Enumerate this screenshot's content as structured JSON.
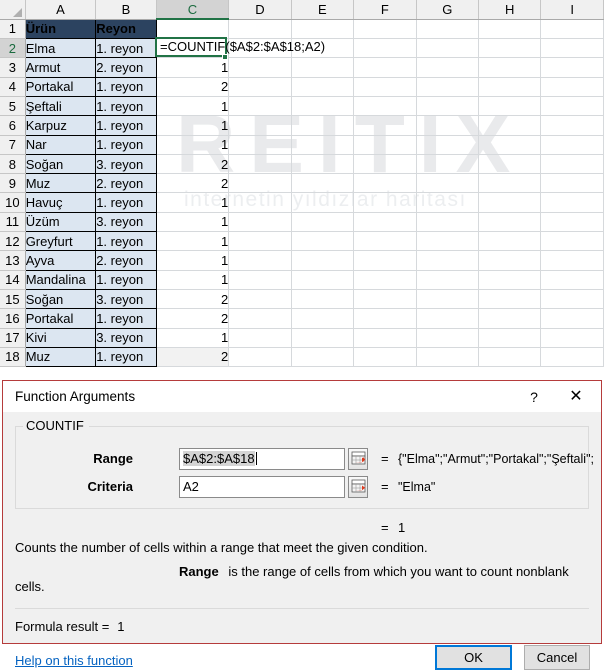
{
  "watermark": {
    "main": "REITIX",
    "sub": "internetin yıldızlar haritası"
  },
  "sheet": {
    "columns": [
      "A",
      "B",
      "C",
      "D",
      "E",
      "F",
      "G",
      "H",
      "I"
    ],
    "selected_column": "C",
    "selected_row": "2",
    "header_row": {
      "number": "1",
      "a": "Ürün",
      "b": "Reyon",
      "c": ""
    },
    "active_cell": {
      "ref": "C2",
      "formula": "=COUNTIF($A$2:$A$18;A2)"
    },
    "rows": [
      {
        "n": "2",
        "a": "Elma",
        "b": "1. reyon",
        "c": ""
      },
      {
        "n": "3",
        "a": "Armut",
        "b": "2. reyon",
        "c": "1"
      },
      {
        "n": "4",
        "a": "Portakal",
        "b": "1. reyon",
        "c": "2"
      },
      {
        "n": "5",
        "a": "Şeftali",
        "b": "1. reyon",
        "c": "1"
      },
      {
        "n": "6",
        "a": "Karpuz",
        "b": "1. reyon",
        "c": "1"
      },
      {
        "n": "7",
        "a": "Nar",
        "b": "1. reyon",
        "c": "1"
      },
      {
        "n": "8",
        "a": "Soğan",
        "b": "3. reyon",
        "c": "2"
      },
      {
        "n": "9",
        "a": "Muz",
        "b": "2. reyon",
        "c": "2"
      },
      {
        "n": "10",
        "a": "Havuç",
        "b": "1. reyon",
        "c": "1"
      },
      {
        "n": "11",
        "a": "Üzüm",
        "b": "3. reyon",
        "c": "1"
      },
      {
        "n": "12",
        "a": "Greyfurt",
        "b": "1. reyon",
        "c": "1"
      },
      {
        "n": "13",
        "a": "Ayva",
        "b": "2. reyon",
        "c": "1"
      },
      {
        "n": "14",
        "a": "Mandalina",
        "b": "1. reyon",
        "c": "1"
      },
      {
        "n": "15",
        "a": "Soğan",
        "b": "3. reyon",
        "c": "2"
      },
      {
        "n": "16",
        "a": "Portakal",
        "b": "1. reyon",
        "c": "2"
      },
      {
        "n": "17",
        "a": "Kivi",
        "b": "3. reyon",
        "c": "1"
      },
      {
        "n": "18",
        "a": "Muz",
        "b": "1. reyon",
        "c": "2"
      }
    ]
  },
  "dialog": {
    "title": "Function Arguments",
    "help_char": "?",
    "close_char": "✕",
    "function_name": "COUNTIF",
    "args": [
      {
        "label": "Range",
        "value": "$A$2:$A$18",
        "eq": "=",
        "eq_value": "{\"Elma\";\"Armut\";\"Portakal\";\"Şeftali\";\"..."
      },
      {
        "label": "Criteria",
        "value": "A2",
        "eq": "=",
        "eq_value": "\"Elma\""
      }
    ],
    "result_eq": "=",
    "result_value": "1",
    "description": "Counts the number of cells within a range that meet the given condition.",
    "arg_help_name": "Range",
    "arg_help_text": "is the range of cells from which you want to count nonblank cells.",
    "formula_result_label": "Formula result =",
    "formula_result_value": "1",
    "help_link": "Help on this function",
    "ok_label": "OK",
    "cancel_label": "Cancel"
  }
}
